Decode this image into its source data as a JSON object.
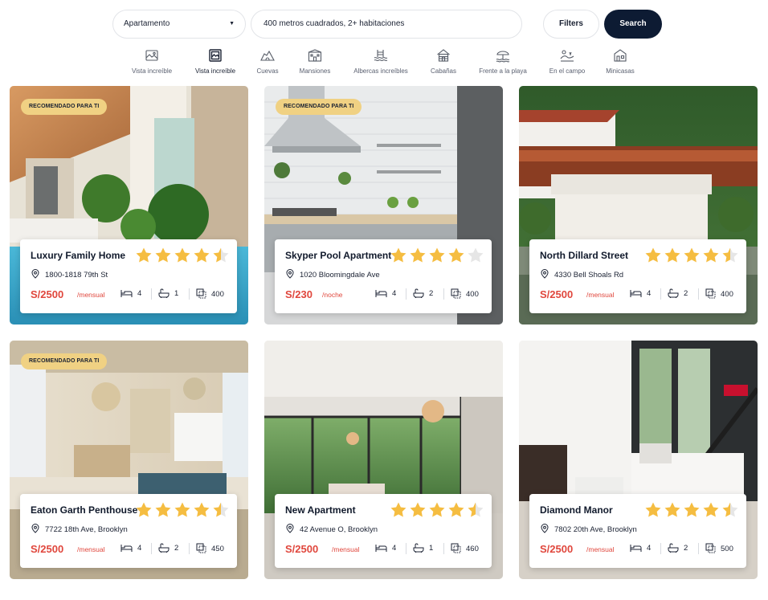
{
  "search": {
    "type_selected": "Apartamento",
    "query": "400 metros cuadrados, 2+ habitaciones",
    "filters_label": "Filters",
    "search_label": "Search"
  },
  "categories": [
    {
      "label": "Vista increíble",
      "icon": "landscape-picture-icon"
    },
    {
      "label": "Vista increíble",
      "icon": "framed-view-icon"
    },
    {
      "label": "Cuevas",
      "icon": "cave-icon"
    },
    {
      "label": "Mansiones",
      "icon": "mansion-icon"
    },
    {
      "label": "Albercas increíbles",
      "icon": "pool-waves-icon"
    },
    {
      "label": "Cabañas",
      "icon": "cabin-icon"
    },
    {
      "label": "Frente a la playa",
      "icon": "beach-icon"
    },
    {
      "label": "En el campo",
      "icon": "countryside-icon"
    },
    {
      "label": "Minicasas",
      "icon": "tiny-house-icon"
    }
  ],
  "listings": [
    {
      "badge": "RECOMENDADO PARA TI",
      "title": "Luxury Family Home",
      "rating": 4.5,
      "address": "1800-1818 79th St",
      "price": "S/2500",
      "period": "/mensual",
      "beds": "4",
      "baths": "1",
      "area": "400"
    },
    {
      "badge": "RECOMENDADO PARA TI",
      "title": "Skyper Pool Apartment",
      "rating": 4,
      "address": "1020 Bloomingdale Ave",
      "price": "S/230",
      "period": "/noche",
      "beds": "4",
      "baths": "2",
      "area": "400"
    },
    {
      "badge": "",
      "title": "North Dillard Street",
      "rating": 4.5,
      "address": "4330 Bell Shoals Rd",
      "price": "S/2500",
      "period": "/mensual",
      "beds": "4",
      "baths": "2",
      "area": "400"
    },
    {
      "badge": "RECOMENDADO PARA TI",
      "title": "Eaton Garth Penthouse",
      "rating": 4.5,
      "address": "7722 18th Ave, Brooklyn",
      "price": "S/2500",
      "period": "/mensual",
      "beds": "4",
      "baths": "2",
      "area": "450"
    },
    {
      "badge": "",
      "title": "New Apartment",
      "rating": 4.5,
      "address": "42 Avenue O, Brooklyn",
      "price": "S/2500",
      "period": "/mensual",
      "beds": "4",
      "baths": "1",
      "area": "460"
    },
    {
      "badge": "",
      "title": "Diamond Manor",
      "rating": 4.5,
      "address": "7802 20th Ave, Brooklyn",
      "price": "S/2500",
      "period": "/mensual",
      "beds": "4",
      "baths": "2",
      "area": "500"
    }
  ],
  "colors": {
    "accent_dark": "#0d1b33",
    "price_red": "#e0473d",
    "star": "#f5bd41",
    "badge": "#f0d183"
  }
}
